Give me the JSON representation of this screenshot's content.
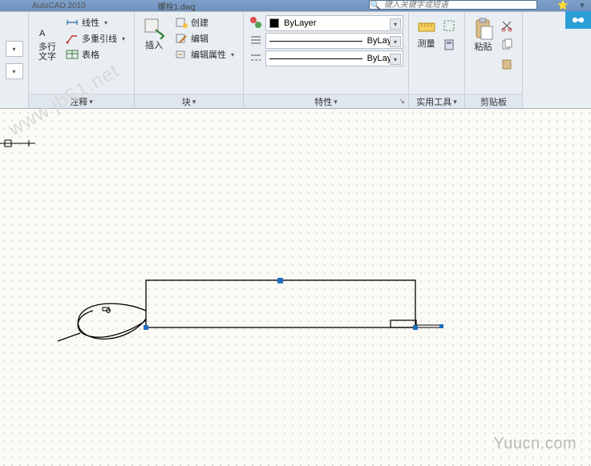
{
  "title": {
    "app": "AutoCAD 2010",
    "file": "螺栓1.dwg"
  },
  "search": {
    "placeholder": "键入关键字或短语"
  },
  "ribbon": {
    "annot": {
      "title": "注释",
      "mtext": "多行\n文字",
      "linear": "线性",
      "mleader": "多重引线",
      "table": "表格"
    },
    "block": {
      "title": "块",
      "insert": "插入",
      "create": "创建",
      "edit": "编辑",
      "editattr": "编辑属性"
    },
    "prop": {
      "title": "特性",
      "color": "ByLayer",
      "lw": "ByLayer",
      "lt": "ByLayer"
    },
    "util": {
      "title": "实用工具",
      "measure": "测量"
    },
    "clip": {
      "title": "剪贴板",
      "paste": "粘贴"
    }
  },
  "watermark": "Yuucn.com",
  "watermark2": "www.jb51.net"
}
